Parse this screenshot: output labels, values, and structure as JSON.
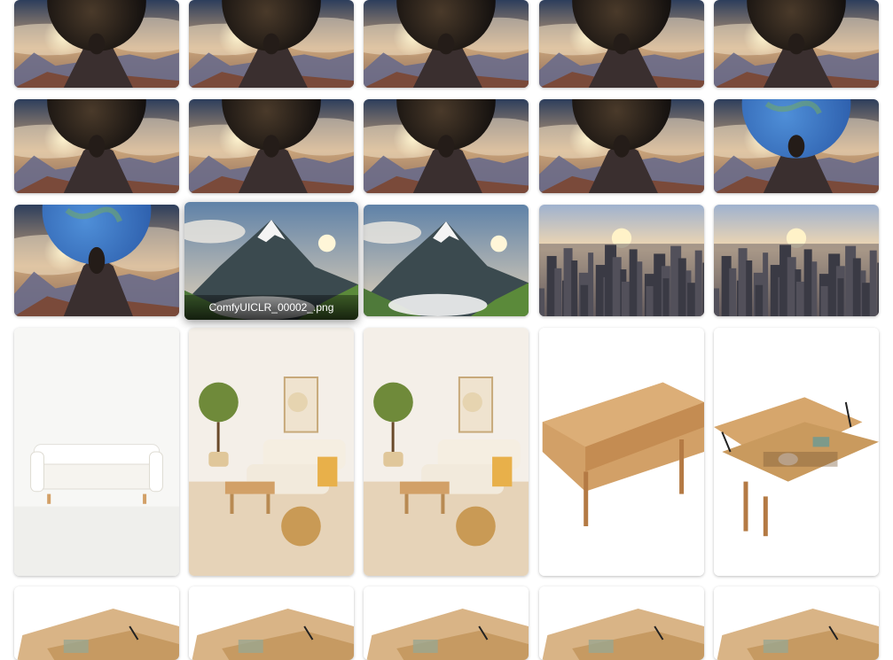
{
  "gallery": {
    "hover_caption": "ComfyUICLR_00002_.png",
    "tiles": [
      {
        "kind": "atlas-dark",
        "planet": "dark"
      },
      {
        "kind": "atlas-dark",
        "planet": "dark"
      },
      {
        "kind": "atlas-dark",
        "planet": "dark"
      },
      {
        "kind": "atlas-dark",
        "planet": "dark"
      },
      {
        "kind": "atlas-dark",
        "planet": "dark"
      },
      {
        "kind": "atlas-dark",
        "planet": "dark"
      },
      {
        "kind": "atlas-dark",
        "planet": "dark"
      },
      {
        "kind": "atlas-dark",
        "planet": "dark"
      },
      {
        "kind": "atlas-dark",
        "planet": "dark"
      },
      {
        "kind": "atlas-earth",
        "planet": "earth"
      },
      {
        "kind": "atlas-earth",
        "planet": "earth"
      },
      {
        "kind": "mountain",
        "hovered": true
      },
      {
        "kind": "mountain"
      },
      {
        "kind": "city"
      },
      {
        "kind": "city"
      },
      {
        "kind": "sofa-white"
      },
      {
        "kind": "living-room"
      },
      {
        "kind": "living-room"
      },
      {
        "kind": "coffee-table"
      },
      {
        "kind": "lift-table"
      },
      {
        "kind": "lift-table-partial"
      },
      {
        "kind": "lift-table-partial"
      },
      {
        "kind": "lift-table-partial"
      },
      {
        "kind": "lift-table-partial"
      },
      {
        "kind": "lift-table-partial"
      }
    ]
  },
  "colors": {
    "sky_top": "#2d3e5c",
    "sky_mid": "#c9a37a",
    "sun": "#fff4cf",
    "mountain_dark": "#3a2f2f",
    "earth_blue": "#2a5aa8",
    "wood": "#d2a067",
    "wall": "#f4efe8"
  }
}
